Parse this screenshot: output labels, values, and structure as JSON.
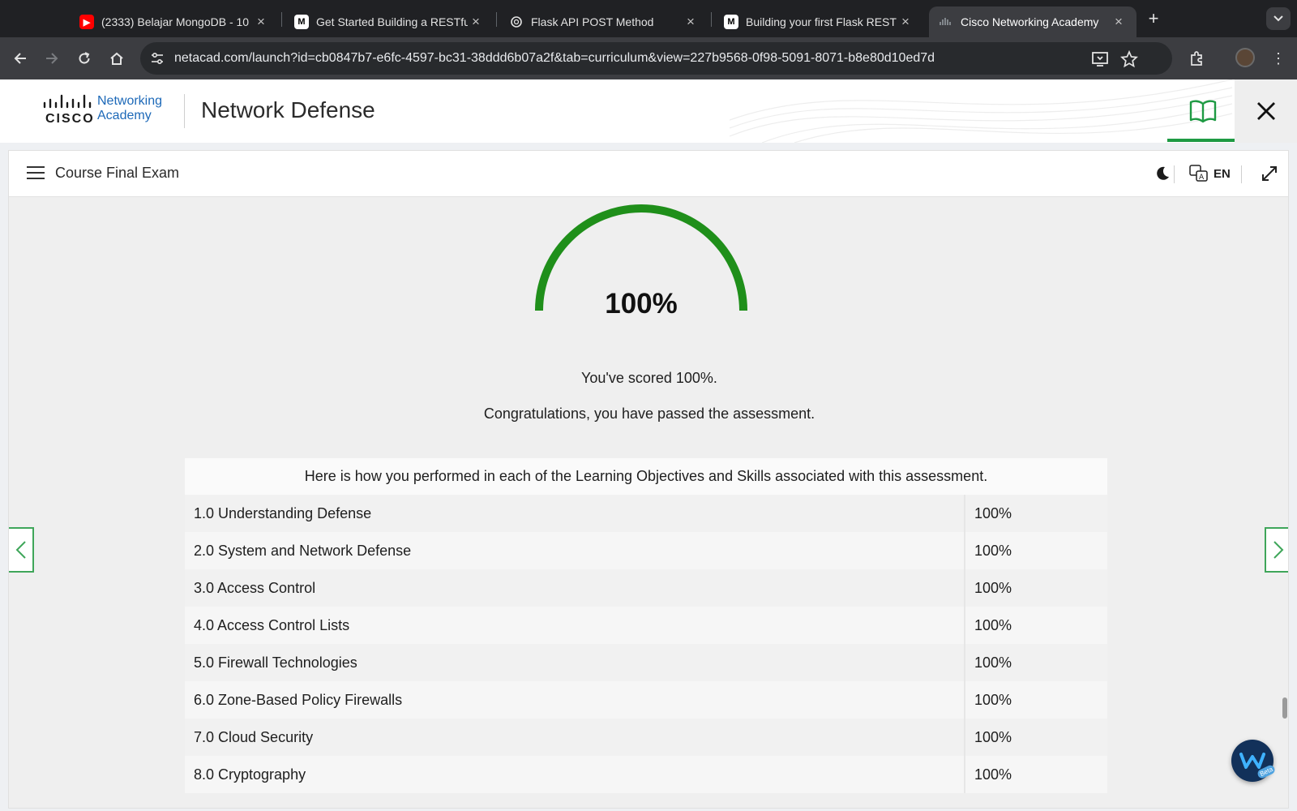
{
  "browser": {
    "tabs": [
      {
        "title": "(2333) Belajar MongoDB - 10",
        "icon": "youtube-icon",
        "active": false
      },
      {
        "title": "Get Started Building a RESTful",
        "icon": "medium-icon",
        "active": false
      },
      {
        "title": "Flask API POST Method",
        "icon": "openai-icon",
        "active": false
      },
      {
        "title": "Building your first Flask REST",
        "icon": "medium-icon",
        "active": false
      },
      {
        "title": "Cisco Networking Academy",
        "icon": "cisco-icon",
        "active": true
      }
    ],
    "new_tab_label": "+",
    "url": "netacad.com/launch?id=cb0847b7-e6fc-4597-bc31-38ddd6b07a2f&tab=curriculum&view=227b9568-0f98-5091-8071-b8e80d10ed7d"
  },
  "header": {
    "logo_wordmark": "cisco",
    "logo_product_line1": "Networking",
    "logo_product_line2": "Academy",
    "course_title": "Network Defense"
  },
  "module_bar": {
    "title": "Course Final Exam",
    "language": "EN"
  },
  "result": {
    "score_percent": 100,
    "score_label": "100%",
    "score_message": "You've scored 100%.",
    "pass_message": "Congratulations, you have passed the assessment."
  },
  "performance": {
    "heading": "Here is how you performed in each of the Learning Objectives and Skills associated with this assessment.",
    "rows": [
      {
        "objective": "1.0 Understanding Defense",
        "score": "100%"
      },
      {
        "objective": "2.0 System and Network Defense",
        "score": "100%"
      },
      {
        "objective": "3.0 Access Control",
        "score": "100%"
      },
      {
        "objective": "4.0 Access Control Lists",
        "score": "100%"
      },
      {
        "objective": "5.0 Firewall Technologies",
        "score": "100%"
      },
      {
        "objective": "6.0 Zone-Based Policy Firewalls",
        "score": "100%"
      },
      {
        "objective": "7.0 Cloud Security",
        "score": "100%"
      },
      {
        "objective": "8.0 Cryptography",
        "score": "100%"
      }
    ]
  },
  "chat_widget": {
    "badge": "Beta"
  },
  "colors": {
    "accent_green": "#1e9a43",
    "gauge_green": "#1f8f1a",
    "cisco_blue": "#1d69b8",
    "chrome_dark": "#202124"
  }
}
